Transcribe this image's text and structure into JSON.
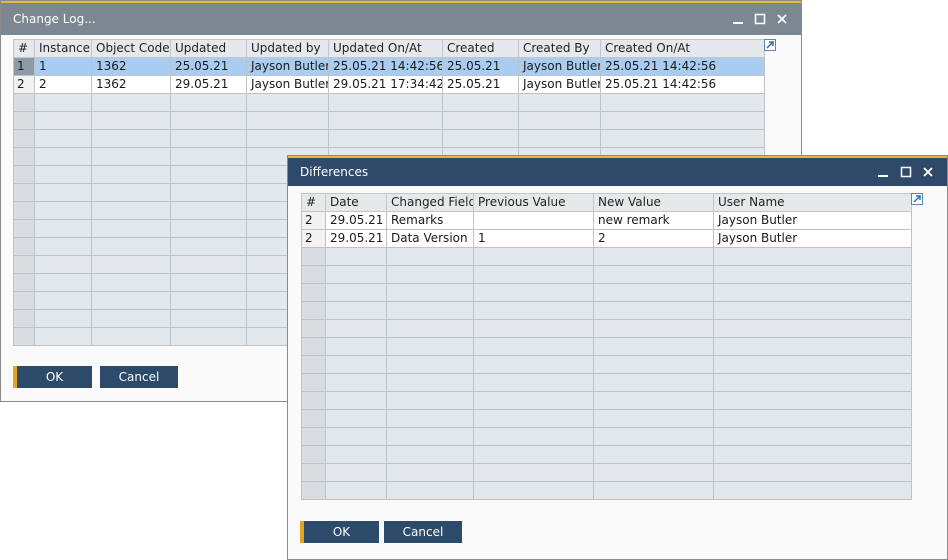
{
  "change_log": {
    "title": "Change Log...",
    "columns": [
      "#",
      "Instance",
      "Object Code",
      "Updated",
      "Updated by",
      "Updated On/At",
      "Created",
      "Created By",
      "Created On/At"
    ],
    "rows": [
      [
        "1",
        "1",
        "1362",
        "25.05.21",
        "Jayson Butler",
        "25.05.21 14:42:56",
        "25.05.21",
        "Jayson Butler",
        "25.05.21 14:42:56"
      ],
      [
        "2",
        "2",
        "1362",
        "29.05.21",
        "Jayson Butler",
        "29.05.21 17:34:42",
        "25.05.21",
        "Jayson Butler",
        "25.05.21 14:42:56"
      ]
    ],
    "selected_row": 0,
    "ok_label": "OK",
    "cancel_label": "Cancel"
  },
  "differences": {
    "title": "Differences",
    "columns": [
      "#",
      "Date",
      "Changed Field",
      "Previous Value",
      "New Value",
      "User Name"
    ],
    "rows": [
      [
        "2",
        "29.05.21",
        "Remarks",
        "",
        "new remark",
        "Jayson Butler"
      ],
      [
        "2",
        "29.05.21",
        "Data Version",
        "1",
        "2",
        "Jayson Butler"
      ]
    ],
    "ok_label": "OK",
    "cancel_label": "Cancel"
  },
  "icons": {
    "minimize": "minimize-icon",
    "maximize": "maximize-icon",
    "close": "close-icon",
    "expand": "expand-arrow-icon"
  },
  "colors": {
    "inactive_titlebar": "#7c8791",
    "active_titlebar": "#2e4a68",
    "accent_gold": "#e9b53b",
    "button": "#2c4b6b",
    "selected_row": "#a9cdf2"
  }
}
